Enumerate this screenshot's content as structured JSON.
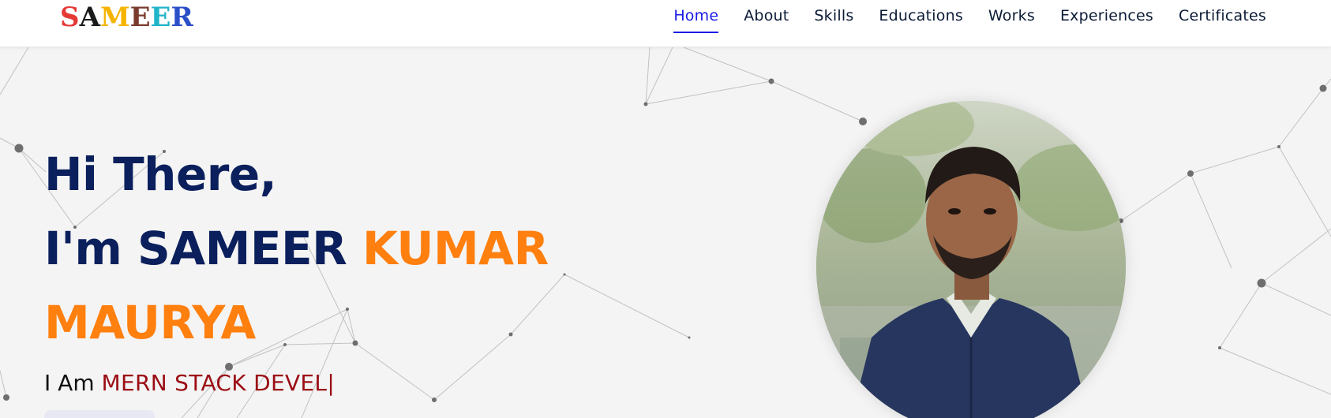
{
  "brand": {
    "letters": [
      {
        "char": "S",
        "color": "#e53935"
      },
      {
        "char": "A",
        "color": "#1b1b1b"
      },
      {
        "char": "M",
        "color": "#f5b400"
      },
      {
        "char": "E",
        "color": "#7a3b2e"
      },
      {
        "char": "E",
        "color": "#20b4c8"
      },
      {
        "char": "R",
        "color": "#2a4fc7"
      }
    ]
  },
  "nav": {
    "items": [
      {
        "label": "Home",
        "active": true
      },
      {
        "label": "About",
        "active": false
      },
      {
        "label": "Skills",
        "active": false
      },
      {
        "label": "Educations",
        "active": false
      },
      {
        "label": "Works",
        "active": false
      },
      {
        "label": "Experiences",
        "active": false
      },
      {
        "label": "Certificates",
        "active": false
      }
    ],
    "active_color": "#1a1ae6"
  },
  "hero": {
    "greeting": "Hi There,",
    "intro_prefix": "I'm SAMEER ",
    "intro_highlight": "KUMAR",
    "intro_last": "MAURYA",
    "typed_prefix": "I Am ",
    "typed_role": "MERN STACK DEVEL",
    "typed_cursor": "|",
    "colors": {
      "navy": "#0a1f5c",
      "orange": "#ff7f0f",
      "role": "#9b0d14"
    }
  }
}
